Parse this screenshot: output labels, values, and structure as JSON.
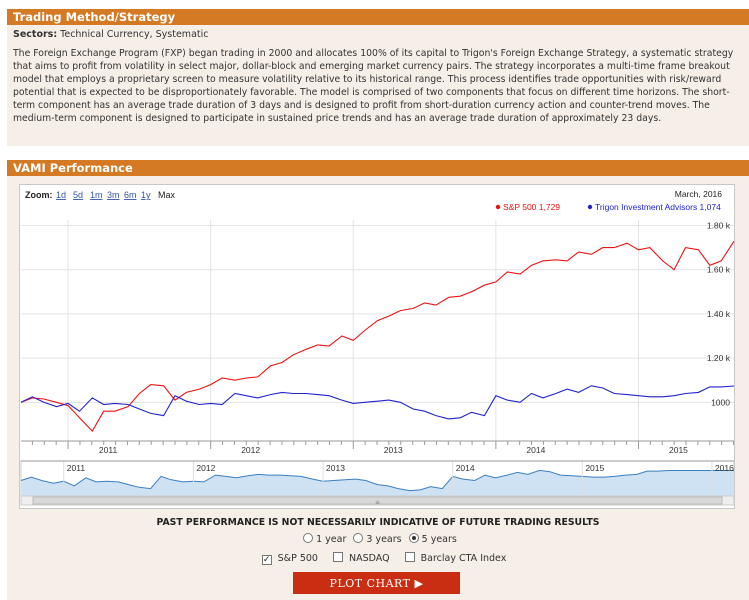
{
  "section1": {
    "title": "Trading Method/Strategy",
    "sectors_label": "Sectors:",
    "sectors_value": "Technical Currency, Systematic",
    "description": "The Foreign Exchange Program (FXP) began trading in 2000 and allocates 100% of its capital to Trigon's Foreign Exchange Strategy, a systematic strategy that aims to profit from volatility in select major, dollar-block and emerging market currency pairs. The strategy incorporates a multi-time frame breakout model that employs a proprietary screen to measure volatility relative to its historical range. This process identifies trade opportunities with risk/reward potential that is expected to be disproportionately favorable. The model is comprised of two components that focus on different time horizons. The short-term component has an average trade duration of 3 days and is designed to profit from short-duration currency action and counter-trend moves. The medium-term component is designed to participate in sustained price trends and has an average trade duration of approximately 23 days."
  },
  "section2": {
    "title": "VAMI Performance"
  },
  "zoom": {
    "label": "Zoom:",
    "options": [
      "1d",
      "5d",
      "1m",
      "3m",
      "6m",
      "1y",
      "Max"
    ]
  },
  "chart_data": {
    "type": "line",
    "date_label": "March, 2016",
    "legend": [
      {
        "name": "S&P 500",
        "value": "1,729",
        "color": "#ee1111"
      },
      {
        "name": "Trigon Investment Advisors",
        "value": "1,074",
        "color": "#2222cc"
      }
    ],
    "y_ticks": [
      "1000",
      "1.20 k",
      "1.40 k",
      "1.60 k",
      "1.80 k"
    ],
    "y_tick_values": [
      1000,
      1200,
      1400,
      1600,
      1800
    ],
    "ylim": [
      825,
      1825
    ],
    "x_ticks": [
      "2011",
      "2012",
      "2013",
      "2014",
      "2015"
    ],
    "x_tick_values": [
      2011.0,
      2012.0,
      2013.0,
      2014.0,
      2015.0
    ],
    "xlim": [
      2010.67,
      2015.67
    ],
    "navigator_ticks": [
      "2011",
      "2012",
      "2013",
      "2014",
      "2015",
      "2016"
    ],
    "navigator_tick_values": [
      2011.0,
      2012.0,
      2013.0,
      2014.0,
      2015.0,
      2016.0
    ],
    "navigator_xlim": [
      2010.67,
      2016.17
    ],
    "series": [
      {
        "name": "S&P 500",
        "color": "#ee1111",
        "x": [
          2010.67,
          2010.75,
          2010.83,
          2010.92,
          2011.0,
          2011.08,
          2011.17,
          2011.25,
          2011.33,
          2011.42,
          2011.5,
          2011.58,
          2011.67,
          2011.75,
          2011.83,
          2011.92,
          2012.0,
          2012.08,
          2012.17,
          2012.25,
          2012.33,
          2012.42,
          2012.5,
          2012.58,
          2012.67,
          2012.75,
          2012.83,
          2012.92,
          2013.0,
          2013.08,
          2013.17,
          2013.25,
          2013.33,
          2013.42,
          2013.5,
          2013.58,
          2013.67,
          2013.75,
          2013.83,
          2013.92,
          2014.0,
          2014.08,
          2014.17,
          2014.25,
          2014.33,
          2014.42,
          2014.5,
          2014.58,
          2014.67,
          2014.75,
          2014.83,
          2014.92,
          2015.0,
          2015.08,
          2015.17,
          2015.25,
          2015.33,
          2015.42,
          2015.5,
          2015.58,
          2015.67
        ],
        "y": [
          1000,
          1020,
          1015,
          1000,
          985,
          930,
          870,
          960,
          960,
          980,
          1040,
          1080,
          1075,
          1010,
          1045,
          1060,
          1080,
          1110,
          1100,
          1110,
          1115,
          1165,
          1180,
          1215,
          1240,
          1260,
          1255,
          1300,
          1280,
          1325,
          1370,
          1390,
          1415,
          1425,
          1450,
          1440,
          1475,
          1480,
          1500,
          1530,
          1545,
          1590,
          1580,
          1620,
          1640,
          1645,
          1640,
          1680,
          1670,
          1700,
          1700,
          1720,
          1690,
          1700,
          1640,
          1600,
          1700,
          1690,
          1620,
          1640,
          1729
        ]
      },
      {
        "name": "Trigon Investment Advisors",
        "color": "#2222cc",
        "x": [
          2010.67,
          2010.75,
          2010.83,
          2010.92,
          2011.0,
          2011.08,
          2011.17,
          2011.25,
          2011.33,
          2011.42,
          2011.5,
          2011.58,
          2011.67,
          2011.75,
          2011.83,
          2011.92,
          2012.0,
          2012.08,
          2012.17,
          2012.25,
          2012.33,
          2012.42,
          2012.5,
          2012.58,
          2012.67,
          2012.75,
          2012.83,
          2012.92,
          2013.0,
          2013.08,
          2013.17,
          2013.25,
          2013.33,
          2013.42,
          2013.5,
          2013.58,
          2013.67,
          2013.75,
          2013.83,
          2013.92,
          2014.0,
          2014.08,
          2014.17,
          2014.25,
          2014.33,
          2014.42,
          2014.5,
          2014.58,
          2014.67,
          2014.75,
          2014.83,
          2014.92,
          2015.0,
          2015.08,
          2015.17,
          2015.25,
          2015.33,
          2015.42,
          2015.5,
          2015.58,
          2015.67
        ],
        "y": [
          1000,
          1025,
          1000,
          980,
          995,
          960,
          1020,
          990,
          995,
          990,
          970,
          950,
          940,
          1030,
          1005,
          990,
          995,
          990,
          1040,
          1030,
          1020,
          1035,
          1045,
          1040,
          1040,
          1035,
          1030,
          1010,
          995,
          1000,
          1005,
          1010,
          1000,
          970,
          960,
          940,
          925,
          930,
          955,
          940,
          1030,
          1010,
          1000,
          1040,
          1020,
          1040,
          1060,
          1045,
          1075,
          1065,
          1040,
          1035,
          1030,
          1025,
          1025,
          1030,
          1040,
          1045,
          1070,
          1070,
          1074
        ]
      }
    ]
  },
  "disclaimer": "PAST PERFORMANCE IS NOT NECESSARILY INDICATIVE OF FUTURE TRADING RESULTS",
  "ranges": {
    "options": [
      "1 year",
      "3 years",
      "5 years"
    ],
    "selected": "5 years"
  },
  "benchmarks": [
    {
      "label": "S&P 500",
      "checked": true
    },
    {
      "label": "NASDAQ",
      "checked": false
    },
    {
      "label": "Barclay CTA Index",
      "checked": false
    }
  ],
  "plot_button": "PLOT CHART ▶"
}
